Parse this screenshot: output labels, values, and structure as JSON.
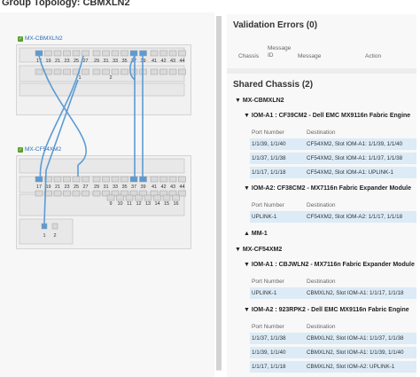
{
  "page_title": "Group Topology: CBMXLN2",
  "topology": {
    "chassis": [
      {
        "name": "MX-CBMXLN2",
        "top_ports": [
          "17",
          "19",
          "21",
          "23",
          "25",
          "27",
          "29",
          "31",
          "33",
          "35",
          "37",
          "39",
          "41",
          "42",
          "43",
          "44"
        ],
        "bottom_ports": [
          "1",
          "2"
        ]
      },
      {
        "name": "MX-CF54XM2",
        "top_ports": [
          "17",
          "19",
          "21",
          "23",
          "25",
          "27",
          "29",
          "31",
          "33",
          "35",
          "37",
          "39",
          "41",
          "42",
          "43",
          "44"
        ],
        "bottom_ports": [
          "9",
          "10",
          "11",
          "12",
          "13",
          "14",
          "15",
          "16"
        ],
        "slot_ports": [
          "1",
          "2"
        ]
      }
    ]
  },
  "validation": {
    "title": "Validation Errors (0)",
    "columns": [
      "Chassis",
      "Message ID",
      "Message",
      "Action"
    ]
  },
  "shared": {
    "title": "Shared Chassis (2)",
    "chassis": [
      {
        "name": "MX-CBMXLN2",
        "modules": [
          {
            "title": "IOM-A1 : CF39CM2 - Dell EMC MX9116n Fabric Engine",
            "headers": [
              "Port Number",
              "Destination"
            ],
            "rows": [
              [
                "1/1/39, 1/1/40",
                "CF54XM2, Slot IOM-A1: 1/1/39, 1/1/40"
              ],
              [
                "1/1/37, 1/1/38",
                "CF54XM2, Slot IOM-A1: 1/1/37, 1/1/38"
              ],
              [
                "1/1/17, 1/1/18",
                "CF54XM2, Slot IOM-A1: UPLINK-1"
              ]
            ]
          },
          {
            "title": "IOM-A2: CF38CM2 - MX7116n Fabric Expander Module",
            "headers": [
              "Port Number",
              "Destination"
            ],
            "rows": [
              [
                "UPLINK-1",
                "CF54XM2, Slot IOM-A2: 1/1/17, 1/1/18"
              ]
            ]
          },
          {
            "title": "MM-1",
            "headers": [],
            "rows": []
          }
        ]
      },
      {
        "name": "MX-CF54XM2",
        "modules": [
          {
            "title": "IOM-A1 : CBJWLN2 - MX7116n Fabric Expander Module",
            "headers": [
              "Port Number",
              "Destination"
            ],
            "rows": [
              [
                "UPLINK-1",
                "CBMXLN2, Slot IOM-A1: 1/1/17, 1/1/18"
              ]
            ]
          },
          {
            "title": "IOM-A2 : 923RPK2 - Dell EMC MX9116n Fabric Engine",
            "headers": [
              "Port Number",
              "Destination"
            ],
            "rows": [
              [
                "1/1/37, 1/1/38",
                "CBMXLN2, Slot IOM-A1: 1/1/37, 1/1/38"
              ],
              [
                "1/1/39, 1/1/40",
                "CBMXLN2, Slot IOM-A1: 1/1/39, 1/1/40"
              ],
              [
                "1/1/17, 1/1/18",
                "CBMXLN2, Slot IOM-A2: UPLINK-1"
              ]
            ]
          }
        ]
      }
    ]
  },
  "colors": {
    "accent": "#2b6fb6",
    "link": "#5b9bd5",
    "row_highlight": "#dcebf6",
    "check": "#5aa02c"
  }
}
